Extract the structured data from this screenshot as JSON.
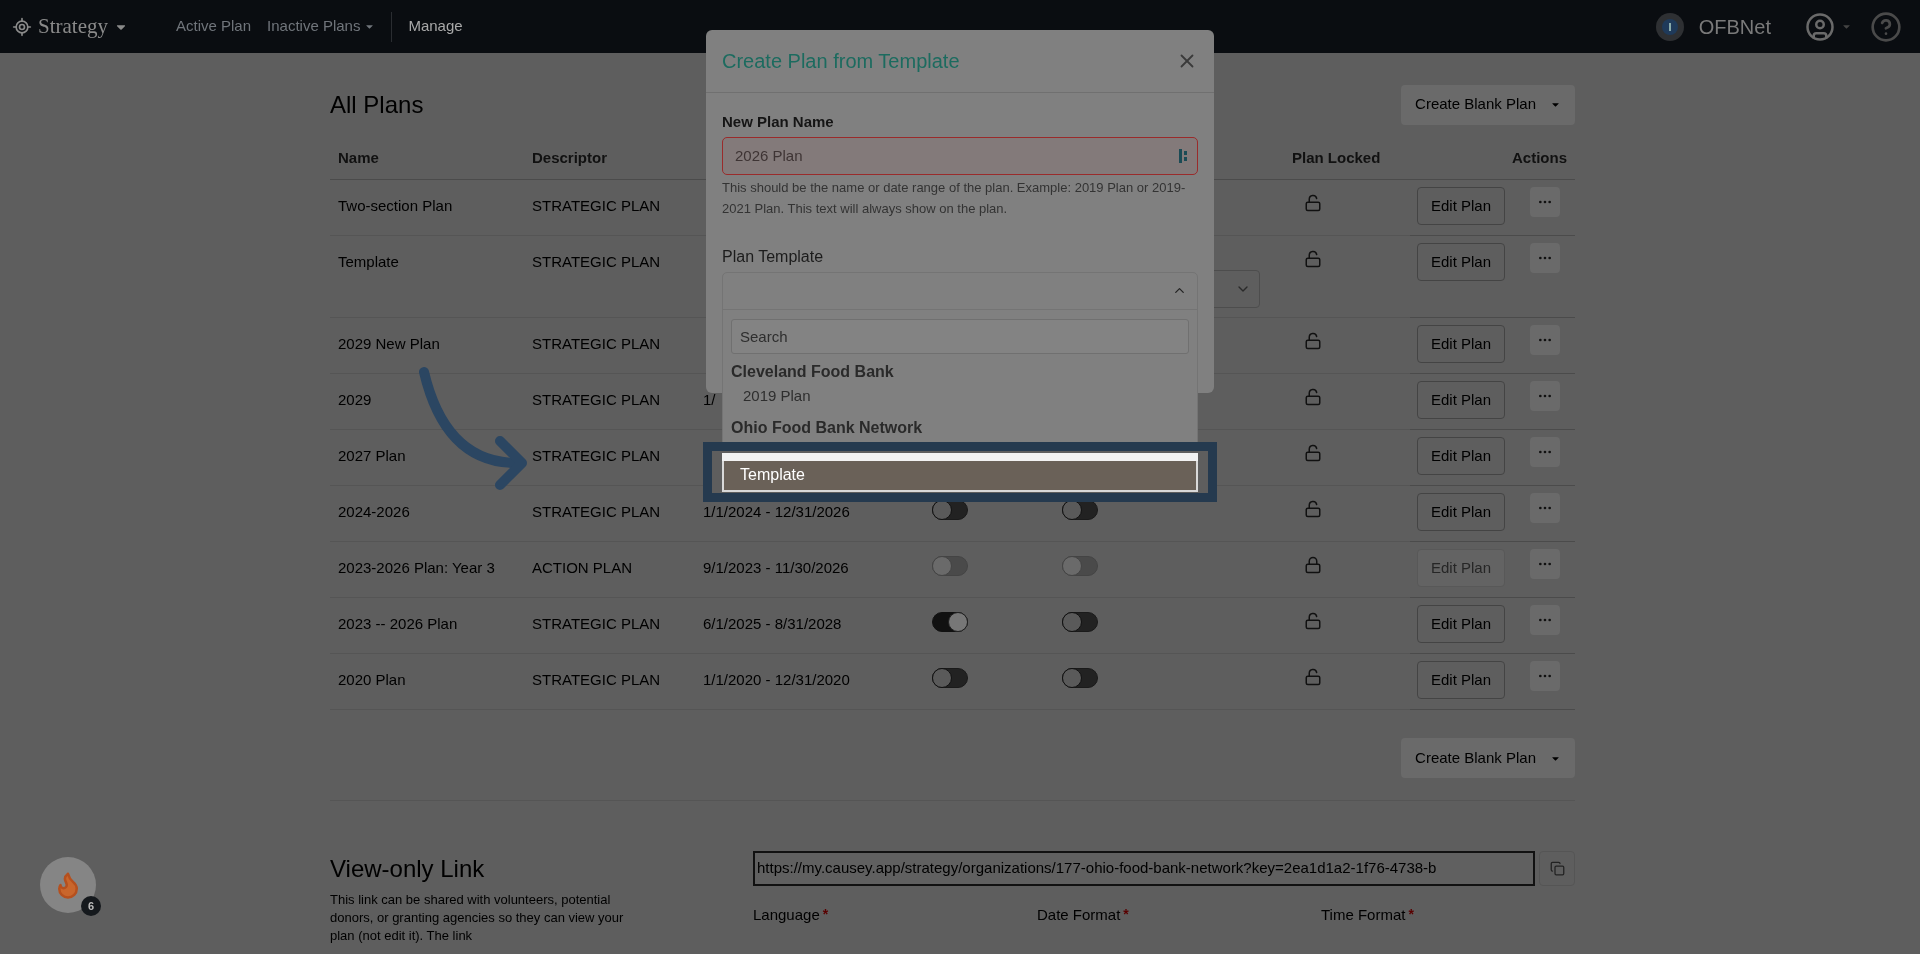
{
  "navbar": {
    "brand": "Strategy",
    "links": [
      {
        "label": "Active Plan",
        "dropdown": false,
        "selected": false
      },
      {
        "label": "Inactive Plans",
        "dropdown": true,
        "selected": false
      },
      {
        "label": "Manage",
        "dropdown": false,
        "selected": true
      }
    ],
    "org": "OFBNet"
  },
  "page_title": "All Plans",
  "create_button": "Create Blank Plan",
  "table": {
    "columns": [
      "Name",
      "Descriptor",
      "Plan Locked",
      "Actions"
    ],
    "rows": [
      {
        "name": "Two-section Plan",
        "descriptor": "STRATEGIC PLAN",
        "locked": false,
        "edit": "Edit Plan",
        "edit_disabled": false
      },
      {
        "name": "Template",
        "descriptor": "STRATEGIC PLAN",
        "locked": false,
        "edit": "Edit Plan",
        "edit_disabled": false,
        "select_stub": true
      },
      {
        "name": "2029 New Plan",
        "descriptor": "STRATEGIC PLAN",
        "locked": false,
        "edit": "Edit Plan",
        "edit_disabled": false
      },
      {
        "name": "2029",
        "descriptor": "STRATEGIC PLAN",
        "dates": "1/",
        "locked": false,
        "edit": "Edit Plan",
        "edit_disabled": false
      },
      {
        "name": "2027 Plan",
        "descriptor": "STRATEGIC PLAN",
        "locked": false,
        "edit": "Edit Plan",
        "edit_disabled": false
      },
      {
        "name": "2024-2026",
        "descriptor": "STRATEGIC PLAN",
        "dates": "1/1/2024 - 12/31/2026",
        "toggle_1": {
          "on": false,
          "disabled": false
        },
        "toggle_2": {
          "on": false,
          "disabled": false
        },
        "locked": false,
        "edit": "Edit Plan",
        "edit_disabled": false
      },
      {
        "name": "2023-2026 Plan: Year 3",
        "descriptor": "ACTION PLAN",
        "dates": "9/1/2023 - 11/30/2026",
        "toggle_1": {
          "on": false,
          "disabled": true
        },
        "toggle_2": {
          "on": false,
          "disabled": true
        },
        "locked": true,
        "edit": "Edit Plan",
        "edit_disabled": true
      },
      {
        "name": "2023 -- 2026 Plan",
        "descriptor": "STRATEGIC PLAN",
        "dates": "6/1/2025 - 8/31/2028",
        "toggle_1": {
          "on": true,
          "disabled": false
        },
        "toggle_2": {
          "on": false,
          "disabled": false
        },
        "locked": false,
        "edit": "Edit Plan",
        "edit_disabled": false
      },
      {
        "name": "2020 Plan",
        "descriptor": "STRATEGIC PLAN",
        "dates": "1/1/2020 - 12/31/2020",
        "toggle_1": {
          "on": false,
          "disabled": false
        },
        "toggle_2": {
          "on": false,
          "disabled": false
        },
        "locked": false,
        "edit": "Edit Plan",
        "edit_disabled": false
      }
    ]
  },
  "bottom_create_button": "Create Blank Plan",
  "view_only": {
    "title": "View-only Link",
    "description": "This link can be shared with volunteers, potential donors, or granting agencies so they can view your plan (not edit it). The link",
    "url": "https://my.causey.app/strategy/organizations/177-ohio-food-bank-network?key=2ea1d1a2-1f76-4738-b",
    "fields": [
      {
        "label": "Language",
        "required_mark": "*"
      },
      {
        "label": "Date Format",
        "required_mark": "*"
      },
      {
        "label": "Time Format",
        "required_mark": "*"
      }
    ]
  },
  "notification_badge": "6",
  "modal": {
    "title": "Create Plan from Template",
    "name_label": "New Plan Name",
    "name_placeholder": "2026 Plan",
    "name_invalid": true,
    "help": "This should be the name or date range of the plan. Example: 2019 Plan or 2019-2021 Plan. This text will always show on the plan.",
    "template_label": "Plan Template",
    "dropdown": {
      "expanded": true,
      "search_placeholder": "Search",
      "groups": [
        {
          "label": "Cleveland Food Bank",
          "options": [
            {
              "label": "2019 Plan",
              "selected": false
            }
          ]
        },
        {
          "label": "Ohio Food Bank Network",
          "options": [
            {
              "label": "Template",
              "selected": true
            }
          ]
        }
      ]
    }
  }
}
